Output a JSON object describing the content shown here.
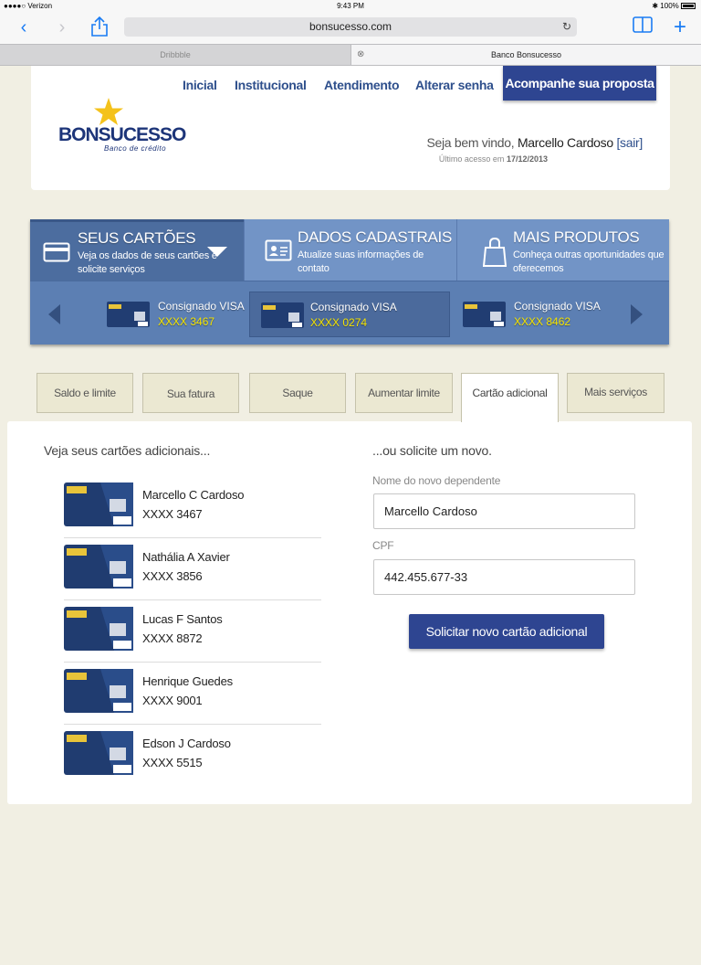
{
  "status_bar": {
    "carrier": "●●●●○ Verizon",
    "time": "9:43 PM",
    "battery": "100%"
  },
  "browser": {
    "url": "bonsucesso.com",
    "tabs": [
      {
        "label": "Dribbble"
      },
      {
        "label": "Banco Bonsucesso"
      }
    ]
  },
  "header": {
    "nav": [
      "Inicial",
      "Institucional",
      "Atendimento",
      "Alterar senha"
    ],
    "cta": "Acompanhe sua proposta",
    "logo_text": "BONSUCESSO",
    "logo_sub": "Banco de crédito",
    "welcome_prefix": "Seja bem vindo,",
    "user_name": "Marcello Cardoso",
    "logout": "sair",
    "last_access_label": "Último acesso em",
    "last_access_date": "17/12/2013"
  },
  "menu": {
    "tabs": [
      {
        "title": "SEUS CARTÕES",
        "subtitle": "Veja os dados de seus cartões e solicite serviços",
        "icon": "credit-card-icon"
      },
      {
        "title": "DADOS CADASTRAIS",
        "subtitle": "Atualize suas informações de contato",
        "icon": "id-card-icon"
      },
      {
        "title": "MAIS PRODUTOS",
        "subtitle": "Conheça outras oportunidades que oferecemos",
        "icon": "shopping-bag-icon"
      }
    ],
    "cards": [
      {
        "name": "Consignado VISA",
        "number": "XXXX 3467"
      },
      {
        "name": "Consignado VISA",
        "number": "XXXX 0274"
      },
      {
        "name": "Consignado VISA",
        "number": "XXXX 8462"
      }
    ]
  },
  "subtabs": [
    "Saldo e limite",
    "Sua fatura",
    "Saque",
    "Aumentar limite",
    "Cartão adicional",
    "Mais serviços"
  ],
  "additional": {
    "left_title": "Veja seus cartões adicionais...",
    "right_title": "...ou solicite um novo.",
    "cards": [
      {
        "name": "Marcello C Cardoso",
        "number": "XXXX 3467"
      },
      {
        "name": "Nathália A Xavier",
        "number": "XXXX 3856"
      },
      {
        "name": "Lucas F Santos",
        "number": "XXXX 8872"
      },
      {
        "name": "Henrique Guedes",
        "number": "XXXX 9001"
      },
      {
        "name": "Edson J Cardoso",
        "number": "XXXX 5515"
      }
    ],
    "dependent_label": "Nome do novo dependente",
    "dependent_value": "Marcello Cardoso",
    "cpf_label": "CPF",
    "cpf_value": "442.455.677-33",
    "submit": "Solicitar novo cartão adicional"
  },
  "colors": {
    "accent": "#2e4591",
    "menu_blue": "#6185b9",
    "card_number_yellow": "#f5e400",
    "page_bg": "#f1efe3"
  }
}
